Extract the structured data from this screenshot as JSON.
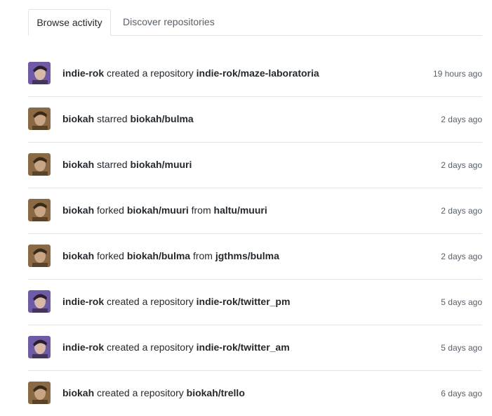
{
  "tabs": {
    "browse_label": "Browse activity",
    "discover_label": "Discover repositories"
  },
  "avatars": {
    "indie_rok": {
      "bg": "#6f5aa8",
      "face": "#d8b9a8",
      "hair": "#2a1d2c"
    },
    "biokah": {
      "bg": "#8a6a44",
      "face": "#c9a585",
      "hair": "#3a2a1a"
    }
  },
  "feed": [
    {
      "avatar": "indie_rok",
      "actor": "indie-rok",
      "verb": "created a repository",
      "repo": "indie-rok/maze-laboratoria",
      "mid": "",
      "source": "",
      "time": "19 hours ago"
    },
    {
      "avatar": "biokah",
      "actor": "biokah",
      "verb": "starred",
      "repo": "biokah/bulma",
      "mid": "",
      "source": "",
      "time": "2 days ago"
    },
    {
      "avatar": "biokah",
      "actor": "biokah",
      "verb": "starred",
      "repo": "biokah/muuri",
      "mid": "",
      "source": "",
      "time": "2 days ago"
    },
    {
      "avatar": "biokah",
      "actor": "biokah",
      "verb": "forked",
      "repo": "biokah/muuri",
      "mid": "from",
      "source": "haltu/muuri",
      "time": "2 days ago"
    },
    {
      "avatar": "biokah",
      "actor": "biokah",
      "verb": "forked",
      "repo": "biokah/bulma",
      "mid": "from",
      "source": "jgthms/bulma",
      "time": "2 days ago"
    },
    {
      "avatar": "indie_rok",
      "actor": "indie-rok",
      "verb": "created a repository",
      "repo": "indie-rok/twitter_pm",
      "mid": "",
      "source": "",
      "time": "5 days ago"
    },
    {
      "avatar": "indie_rok",
      "actor": "indie-rok",
      "verb": "created a repository",
      "repo": "indie-rok/twitter_am",
      "mid": "",
      "source": "",
      "time": "5 days ago"
    },
    {
      "avatar": "biokah",
      "actor": "biokah",
      "verb": "created a repository",
      "repo": "biokah/trello",
      "mid": "",
      "source": "",
      "time": "6 days ago"
    }
  ]
}
